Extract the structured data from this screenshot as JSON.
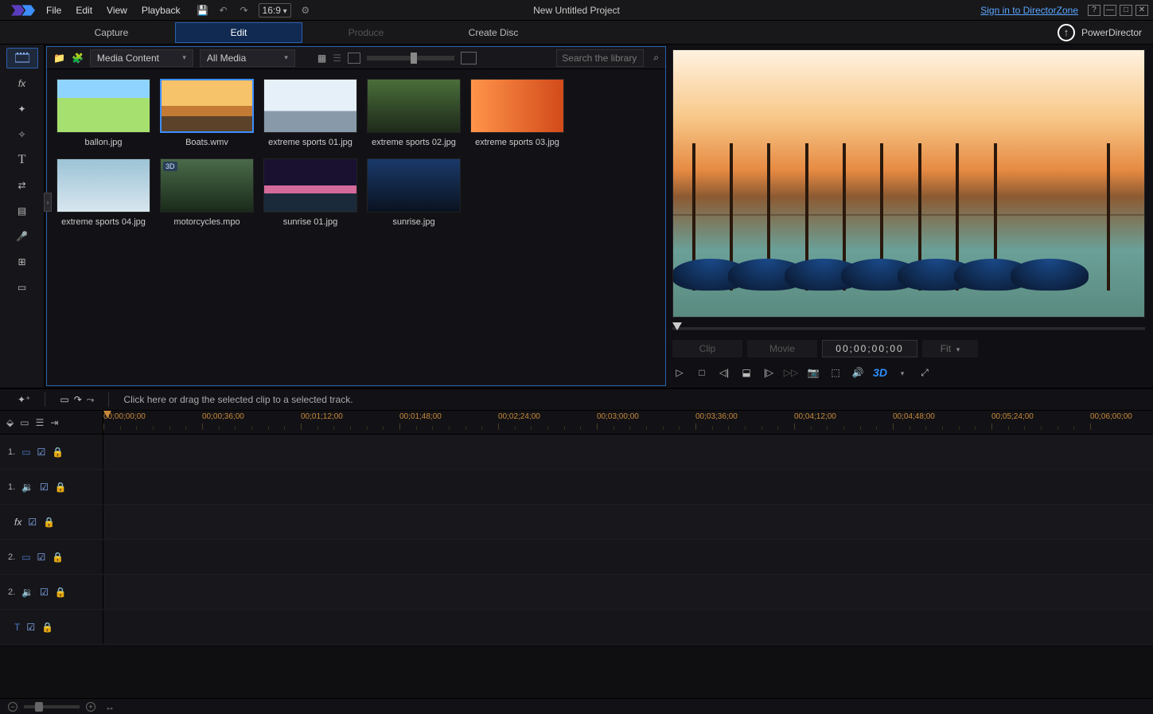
{
  "app": {
    "brand": "PowerDirector",
    "project": "New Untitled Project",
    "signin": "Sign in to DirectorZone",
    "aspect": "16:9"
  },
  "menu": {
    "file": "File",
    "edit": "Edit",
    "view": "View",
    "playback": "Playback"
  },
  "tabs": {
    "capture": "Capture",
    "edit": "Edit",
    "produce": "Produce",
    "createdisc": "Create Disc"
  },
  "lib": {
    "dd1": "Media Content",
    "dd2": "All Media",
    "search_ph": "Search the library",
    "items": [
      {
        "name": "ballon.jpg",
        "cls": "th-balloon"
      },
      {
        "name": "Boats.wmv",
        "cls": "th-boats",
        "sel": true
      },
      {
        "name": "extreme sports 01.jpg",
        "cls": "th-sport1"
      },
      {
        "name": "extreme sports 02.jpg",
        "cls": "th-sport2"
      },
      {
        "name": "extreme sports 03.jpg",
        "cls": "th-sport3"
      },
      {
        "name": "extreme sports 04.jpg",
        "cls": "th-sport4"
      },
      {
        "name": "motorcycles.mpo",
        "cls": "th-moto",
        "badge": "3D"
      },
      {
        "name": "sunrise 01.jpg",
        "cls": "th-sun1"
      },
      {
        "name": "sunrise.jpg",
        "cls": "th-sun2"
      }
    ]
  },
  "preview": {
    "clip": "Clip",
    "movie": "Movie",
    "tc": "00;00;00;00",
    "fit": "Fit",
    "threeD": "3D"
  },
  "dragbar": {
    "hint": "Click here or drag the selected clip to a selected track."
  },
  "timeline": {
    "ruler": [
      "00;00;00;00",
      "00;00;36;00",
      "00;01;12;00",
      "00;01;48;00",
      "00;02;24;00",
      "00;03;00;00",
      "00;03;36;00",
      "00;04;12;00",
      "00;04;48;00",
      "00;05;24;00",
      "00;06;00;00"
    ],
    "tracks": [
      {
        "n": "1.",
        "icon": "video"
      },
      {
        "n": "1.",
        "icon": "audio"
      },
      {
        "n": "fx",
        "icon": "fx"
      },
      {
        "n": "2.",
        "icon": "video"
      },
      {
        "n": "2.",
        "icon": "audio"
      },
      {
        "n": "T",
        "icon": "title"
      }
    ]
  }
}
